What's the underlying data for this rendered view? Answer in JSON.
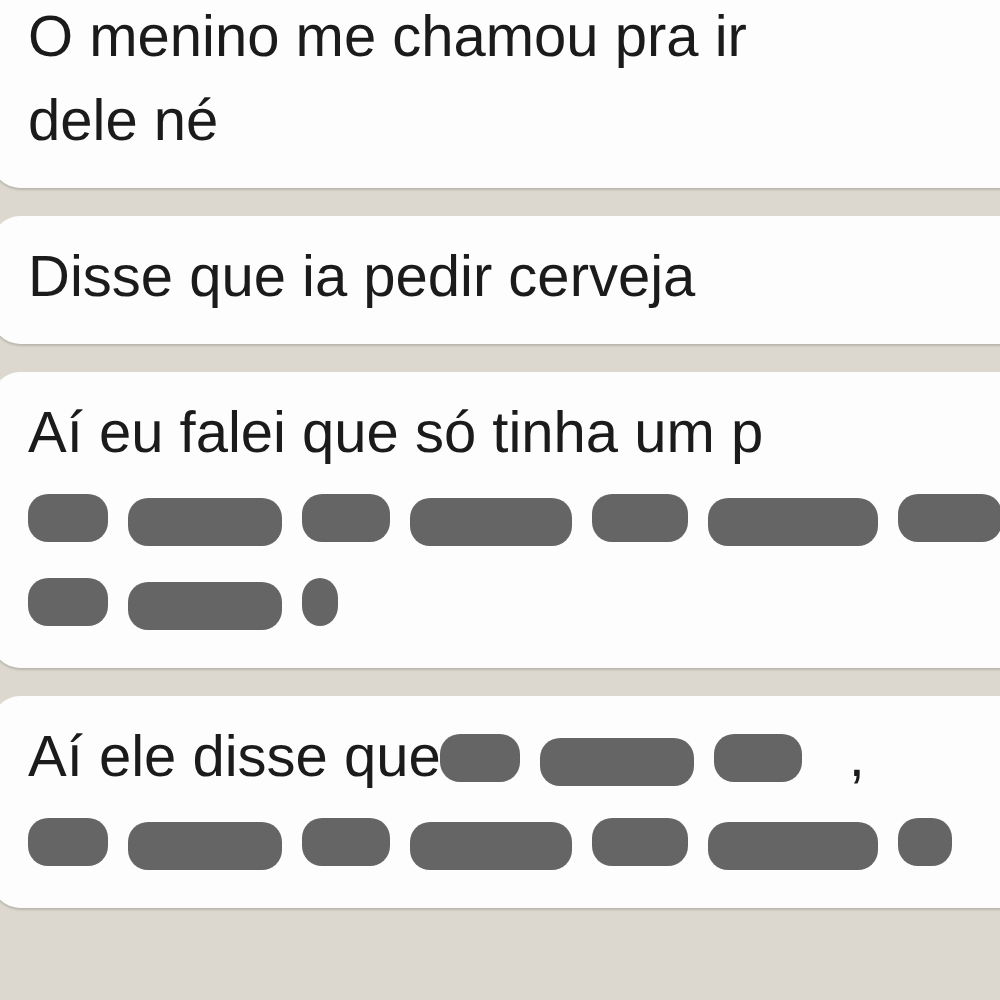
{
  "messages": [
    {
      "lines": [
        [
          {
            "kind": "text",
            "text": "O menino me chamou pra ir"
          }
        ],
        [
          {
            "kind": "text",
            "text": "dele né"
          }
        ]
      ]
    },
    {
      "lines": [
        [
          {
            "kind": "text",
            "text": "Disse que ia pedir cerveja"
          }
        ]
      ]
    },
    {
      "lines": [
        [
          {
            "kind": "text",
            "text": "Aí eu falei que só tinha um p"
          }
        ],
        [
          {
            "kind": "redacted"
          }
        ],
        [
          {
            "kind": "redacted"
          }
        ]
      ]
    },
    {
      "lines": [
        [
          {
            "kind": "text",
            "text": "Aí ele disse que"
          },
          {
            "kind": "redacted"
          },
          {
            "kind": "text",
            "text": ","
          }
        ],
        [
          {
            "kind": "redacted"
          }
        ]
      ]
    }
  ]
}
